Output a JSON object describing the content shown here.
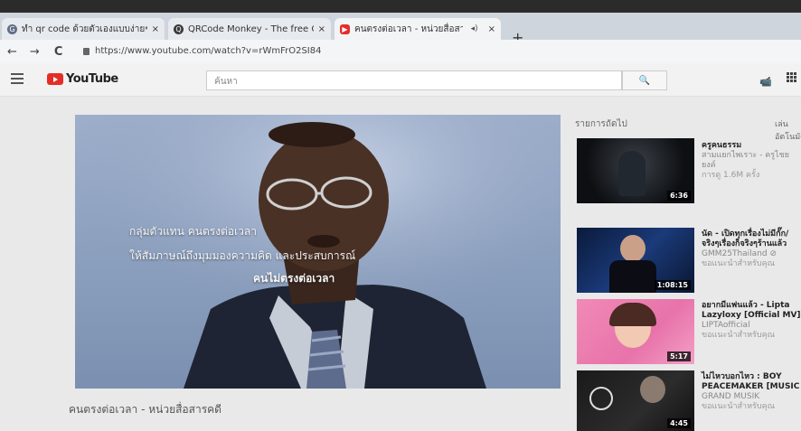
{
  "browser": {
    "tabs": [
      {
        "label": "ทำ qr code ด้วยตัวเองแบบง่ายๆ - ค้นหาด้วย Google",
        "favicon": "G",
        "favicon_color": "#5f6f86"
      },
      {
        "label": "QRCode Monkey - The free QR Code Generator",
        "favicon": "Q",
        "favicon_color": "#3a3a3a"
      },
      {
        "label": "คนตรงต่อเวลา - หน่วยสื่อสารคดี - YouTube",
        "favicon": "▶",
        "favicon_color": "#e52d27"
      }
    ],
    "close_icon": "×",
    "new_tab_icon": "+",
    "nav": {
      "back": "←",
      "forward": "→",
      "reload": "C"
    },
    "url": "https://www.youtube.com/watch?v=rWmFrO2SI84"
  },
  "youtube": {
    "logo_text": "YouTube",
    "search_placeholder": "ค้นหา",
    "search_icon": "🔍",
    "camera_icon": "📹"
  },
  "player": {
    "caption_line1": "กลุ่มตัวแทน คนตรงต่อเวลา",
    "caption_line2": "ให้สัมภาษณ์ถึงมุมมองความคิด และประสบการณ์",
    "caption_line3": "คนไม่ตรงต่อเวลา"
  },
  "video_title": "คนตรงต่อเวลา - หน่วยสื่อสารคดี",
  "sidebar": {
    "up_next_label": "รายการถัดไป",
    "autoplay_label": "เล่นอัตโนมัติ",
    "videos": [
      {
        "title": "ครูคนธรรม",
        "channel": "สามแยกไพเราะ - ครูไชยยงค์",
        "meta": "การดู 1.6M ครั้ง",
        "duration": "6:36"
      },
      {
        "title": "นัด - เปิดทุกเรื่องไม่มีกั๊ก/จริงๆเรื่องก็จริงๆร้านแล้ว",
        "channel": "GMM25Thailand ⊘",
        "meta": "ขอแนะนำสำหรับคุณ",
        "duration": "1:08:15"
      },
      {
        "title": "อยากมีแฟนแล้ว - Lipta Lazyloxy [Official MV]",
        "channel": "LIPTAofficial",
        "meta": "ขอแนะนำสำหรับคุณ",
        "duration": "5:17"
      },
      {
        "title": "ไม่ไหวบอกไหว : BOY PEACEMAKER [MUSIC",
        "channel": "GRAND MUSIK",
        "meta": "ขอแนะนำสำหรับคุณ",
        "duration": "4:45"
      }
    ]
  }
}
